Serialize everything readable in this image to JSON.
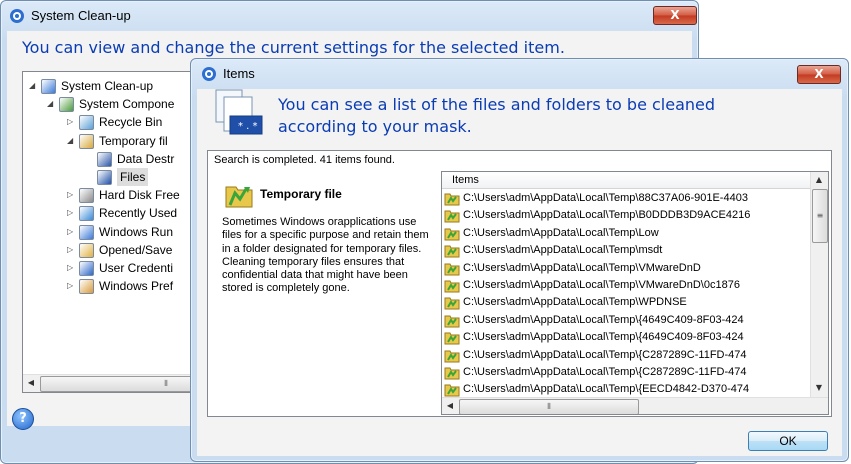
{
  "back_window": {
    "title": "System Clean-up",
    "close": "X",
    "subtitle": "You can view and change the current settings for the selected item.",
    "tree": [
      {
        "label": "System Clean-up",
        "twist": "◢",
        "icon": "system-cleanup-icon"
      },
      {
        "label": "System Compone",
        "twist": "◢",
        "icon": "components-icon"
      },
      {
        "label": "Recycle Bin",
        "twist": "▷",
        "icon": "recycle-bin-icon"
      },
      {
        "label": "Temporary fil",
        "twist": "◢",
        "icon": "temp-files-icon"
      },
      {
        "label": "Data Destr",
        "twist": "",
        "icon": "data-destruction-icon"
      },
      {
        "label": "Files",
        "twist": "",
        "icon": "files-icon"
      },
      {
        "label": "Hard Disk Free",
        "twist": "▷",
        "icon": "hard-disk-icon"
      },
      {
        "label": "Recently Used",
        "twist": "▷",
        "icon": "recently-used-icon"
      },
      {
        "label": "Windows Run",
        "twist": "▷",
        "icon": "windows-run-icon"
      },
      {
        "label": "Opened/Save",
        "twist": "▷",
        "icon": "opened-saved-icon"
      },
      {
        "label": "User Credenti",
        "twist": "▷",
        "icon": "user-credentials-icon"
      },
      {
        "label": "Windows Pref",
        "twist": "▷",
        "icon": "windows-prefetch-icon"
      }
    ],
    "help": "?"
  },
  "dialog": {
    "title": "Items",
    "close": "X",
    "header_line1": "You can see a list of the files and folders to be cleaned",
    "header_line2": "according to your mask.",
    "status": "Search is completed. 41 items found.",
    "item_title": "Temporary file",
    "description": "Sometimes Windows orapplications use files for a specific purpose and retain them in a folder designated for temporary files. Cleaning temporary files ensures that confidential data that might have been stored is completely gone.",
    "column_header": "Items",
    "rows": [
      "C:\\Users\\adm\\AppData\\Local\\Temp\\88C37A06-901E-4403",
      "C:\\Users\\adm\\AppData\\Local\\Temp\\B0DDDB3D9ACE4216",
      "C:\\Users\\adm\\AppData\\Local\\Temp\\Low",
      "C:\\Users\\adm\\AppData\\Local\\Temp\\msdt",
      "C:\\Users\\adm\\AppData\\Local\\Temp\\VMwareDnD",
      "C:\\Users\\adm\\AppData\\Local\\Temp\\VMwareDnD\\0c1876",
      "C:\\Users\\adm\\AppData\\Local\\Temp\\WPDNSE",
      "C:\\Users\\adm\\AppData\\Local\\Temp\\{4649C409-8F03-424",
      "C:\\Users\\adm\\AppData\\Local\\Temp\\{4649C409-8F03-424",
      "C:\\Users\\adm\\AppData\\Local\\Temp\\{C287289C-11FD-474",
      "C:\\Users\\adm\\AppData\\Local\\Temp\\{C287289C-11FD-474",
      "C:\\Users\\adm\\AppData\\Local\\Temp\\{EECD4842-D370-474"
    ],
    "ok": "OK"
  },
  "colors": {
    "accent": "#0a3cb4",
    "frame": "#c9dcf0",
    "close": "#c23a22"
  }
}
